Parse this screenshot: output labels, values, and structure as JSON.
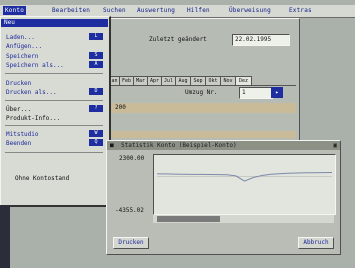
{
  "menubar": {
    "items": [
      "Konto",
      "Bearbeiten",
      "Suchen",
      "Auswertung",
      "Hilfen",
      "Überweisung",
      "Extras"
    ]
  },
  "file_menu": {
    "header": "Neu",
    "items": [
      {
        "label": "Laden...",
        "shortcut": "L"
      },
      {
        "label": "Anfügen...",
        "shortcut": ""
      },
      {
        "label": "Speichern",
        "shortcut": "S"
      },
      {
        "label": "Speichern als...",
        "shortcut": "A"
      },
      {
        "label": "Drucken",
        "shortcut": ""
      },
      {
        "label": "Drucken als...",
        "shortcut": "D"
      },
      {
        "label": "Über...",
        "shortcut": "?"
      },
      {
        "label": "Produkt-Info...",
        "shortcut": ""
      },
      {
        "label": "Mitstudio",
        "shortcut": "W"
      },
      {
        "label": "Beenden",
        "shortcut": "Q"
      }
    ],
    "status": "Ohne Kontostand"
  },
  "main": {
    "zuletzt_label": "Zuletzt geändert",
    "zuletzt_value": "22.02.1995",
    "tabs": [
      "Jan",
      "Feb",
      "Mar",
      "Apr",
      "Jul",
      "Aug",
      "Sep",
      "Okt",
      "Nov",
      "Dez"
    ],
    "umzug_label": "Umzug Nr.",
    "umzug_value": "1",
    "row_value": "200"
  },
  "stats_window": {
    "title": "Statistik Konto (Beispiel-Konto)",
    "y_max": "2300.00",
    "y_min": "-4355.02",
    "button_print": "Drucken",
    "button_cancel": "Abbruch"
  },
  "chart_data": {
    "type": "line",
    "ylim": [
      -4355.02,
      2300.0
    ],
    "x": [
      0,
      1,
      2,
      3,
      4,
      5,
      6,
      7,
      8,
      9,
      10,
      11,
      12,
      13,
      14,
      15,
      16,
      17,
      18,
      19,
      20
    ],
    "series": [
      {
        "values": [
          300,
          300,
          280,
          250,
          240,
          240,
          230,
          220,
          200,
          50,
          -600,
          -150,
          100,
          260,
          320,
          380,
          420,
          440,
          460,
          470,
          480
        ]
      }
    ]
  },
  "colors": {
    "accent": "#1e2da0",
    "background": "#aab0aa",
    "chart_line": "#7c8aa8"
  }
}
